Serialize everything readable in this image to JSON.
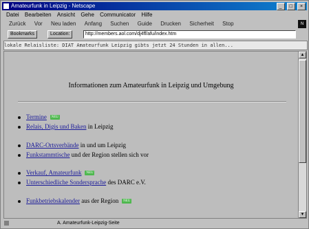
{
  "window": {
    "title": "Amateurfunk in Leipzig - Netscape",
    "controls": [
      "_",
      "□",
      "×"
    ]
  },
  "menu": [
    "Datei",
    "Bearbeiten",
    "Ansicht",
    "Gehe",
    "Communicator",
    "Hilfe"
  ],
  "toolbar": [
    "Zurück",
    "Vor",
    "Neu laden",
    "Anfang",
    "Suchen",
    "Guide",
    "Drucken",
    "Sicherheit",
    "Stop"
  ],
  "location": {
    "bookmarks_label": "Bookmarks",
    "location_label": "Location:",
    "url": "http://members.aol.com/dj4ff/afu/index.htm"
  },
  "ticker": "lokale Relaisliste: DIAT Amateurfunk Leipzig gibts jetzt 24 Stunden in allen...",
  "content": {
    "heading": "Informationen zum Amateurfunk in Leipzig und Umgebung",
    "groups": [
      {
        "items": [
          {
            "link": "Termine",
            "rest": "",
            "new": true
          },
          {
            "link": "Relais, Digis und Baken",
            "rest": " in Leipzig",
            "new": false
          }
        ]
      },
      {
        "items": [
          {
            "link": "DARC-Ortsverbände",
            "rest": " in und um Leipzig",
            "new": false
          },
          {
            "link": "Funkstammtische",
            "rest": " und der Region stellen sich vor",
            "new": false
          }
        ]
      },
      {
        "items": [
          {
            "link": "Verkauf, Amateurfunk",
            "rest": "",
            "new": true
          },
          {
            "link": "Unterschiedliche Sondersprache",
            "rest": " des DARC e.V.",
            "new": false
          }
        ]
      },
      {
        "items": [
          {
            "link": "Funkbetriebskalender",
            "rest": " aus der Region",
            "new": true
          }
        ]
      }
    ],
    "new_badge": "NEU"
  },
  "status": {
    "text": "A. Amateurfunk-Leipzig-Seite"
  }
}
